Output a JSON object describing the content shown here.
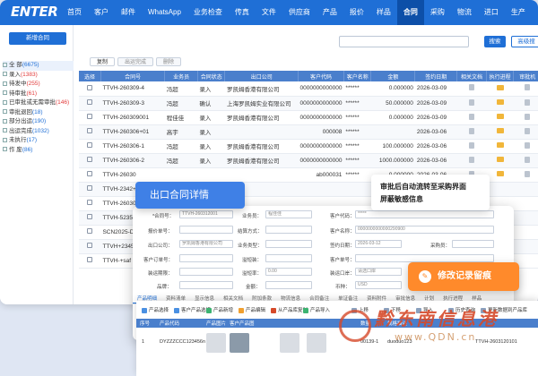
{
  "app": {
    "logo": "ENTER",
    "nav": [
      "首页",
      "客户",
      "邮件",
      "WhatsApp",
      "业务检查",
      "传真",
      "文件",
      "供应商",
      "产品",
      "报价",
      "样品",
      "合同",
      "采购",
      "物流",
      "进口",
      "生产"
    ],
    "active_nav": "合同"
  },
  "sidebar": {
    "new_button": "新增合同",
    "items": [
      {
        "label": "全 部",
        "count": "(6675)"
      },
      {
        "label": "录入",
        "count": "(1383)"
      },
      {
        "label": "待发中",
        "count": "(255)"
      },
      {
        "label": "待审批",
        "count": "(61)"
      },
      {
        "label": "已审批或无需审批",
        "count": "(146)"
      },
      {
        "label": "审批退回",
        "count": "(18)"
      },
      {
        "label": "部分出运",
        "count": "(190)"
      },
      {
        "label": "出运完成",
        "count": "(1032)"
      },
      {
        "label": "未执行",
        "count": "(17)"
      },
      {
        "label": "作 废",
        "count": "(86)"
      }
    ]
  },
  "toolbar": {
    "search_button": "搜索",
    "advanced_button": "高级搜",
    "buttons": [
      "复制",
      "出运完成",
      "删除"
    ]
  },
  "table": {
    "headers": [
      "选择",
      "合同号",
      "业务员",
      "合同状态",
      "出口公司",
      "客户代码",
      "客户名称",
      "金额",
      "签约日期",
      "相关文档",
      "执行进程",
      "审批机"
    ],
    "rows": [
      [
        "TTVH-260309-4",
        "冯超",
        "录入",
        "罗凯姆香港有限公司",
        "0000000000000",
        "******",
        "0.000000",
        "2026-03-09"
      ],
      [
        "TTVH-260309-3",
        "冯超",
        "确认",
        "上海罗凯姆实业有限公司",
        "0000000000000",
        "******",
        "50.000000",
        "2026-03-09"
      ],
      [
        "TTVH-260309001",
        "程佳佳",
        "录入",
        "罗凯姆香港有限公司",
        "0000000000000",
        "******",
        "0.000000",
        "2026-03-09"
      ],
      [
        "TTVH-260306+01",
        "高宇",
        "录入",
        "",
        "000008",
        "******",
        "",
        "2026-03-06"
      ],
      [
        "TTVH-260306-1",
        "冯超",
        "录入",
        "罗凯姆香港有限公司",
        "0000000000000",
        "******",
        "100.000000",
        "2026-03-06"
      ],
      [
        "TTVH-260306-2",
        "冯超",
        "录入",
        "罗凯姆香港有限公司",
        "0000000000000",
        "******",
        "1000.000000",
        "2026-03-06"
      ],
      [
        "TTVH-26030",
        "",
        "",
        "",
        "ab000031",
        "******",
        "0.000000",
        "2026-03-06"
      ],
      [
        "TTVH-2342+",
        "",
        "",
        "",
        "",
        "",
        "",
        ""
      ],
      [
        "TTVH-26030",
        "",
        "",
        "",
        "",
        "",
        "",
        ""
      ],
      [
        "TTVH-52352",
        "",
        "",
        "",
        "",
        "",
        "",
        ""
      ],
      [
        "SCN2025-D8",
        "",
        "",
        "",
        "",
        "",
        "",
        ""
      ],
      [
        "TTVH+23453",
        "",
        "",
        "",
        "",
        "",
        "",
        ""
      ],
      [
        "TTVH-+saf",
        "",
        "",
        "",
        "",
        "",
        "",
        ""
      ]
    ]
  },
  "detail": {
    "callout": "出口合同详情",
    "fields": {
      "contract_no_label": "*合同号：",
      "contract_no_value": "TTVH-260312001",
      "salesperson_label": "业务员：",
      "salesperson_value": "程佳佳",
      "customer_code_label": "客户代码：",
      "customer_code_value": "*****",
      "quote_no_label": "报价单号：",
      "settlement_label": "结算方式：",
      "customer_name_label": "客户名称：",
      "customer_name_value": "0000000000000290900",
      "export_company_label": "出口公司：",
      "export_company_value": "罗凯姆香港有限公司",
      "business_type_label": "业务类型：",
      "sign_date_label": "签约日期：",
      "sign_date_value": "2026-03-12",
      "purchaser_label": "采购员：",
      "customer_order_label": "客户订单号：",
      "delivery_label": "溢短装：",
      "customer_po_label": "客户单号：",
      "ship_date_label": "装运期限：",
      "deposit_label": "溢短率：",
      "deposit_value": "0.00",
      "port_label": "装运口岸：",
      "port_value": "请选口岸",
      "brand_label": "品牌：",
      "coinage_label": "金额：",
      "currency_label": "币种：",
      "currency_value": "USD"
    },
    "tabs": [
      "产品明细",
      "资料清单",
      "显示信息",
      "相关文档",
      "附加条款",
      "物流信息",
      "合同备注",
      "单证备注",
      "资料附件",
      "审批信息",
      "计划",
      "执行进程",
      "样品"
    ]
  },
  "callout_top_right": {
    "line1": "审批后自动流转至采购界面",
    "line2": "屏蔽敏感信息"
  },
  "callout_orange": "修改记录留痕",
  "product": {
    "tools": [
      "产品选择",
      "客户产品选择",
      "产品新增",
      "产品编辑",
      "从产品库复制",
      "产品导入"
    ],
    "tools_right": [
      "上移",
      "下移",
      "导入",
      "历史查询",
      "更新数据到产品库"
    ],
    "headers": [
      "序号",
      "产品代码",
      "产品图片",
      "客户产品图",
      "",
      "",
      "",
      "",
      "数量",
      "",
      "",
      "规格描述"
    ],
    "row": {
      "index": "1",
      "code": "DYZZZCCC123456n",
      "customer_code": "00139-1",
      "spec_code": "duoduo123",
      "tail_code": "TTVH-2603120101"
    }
  },
  "watermark": {
    "text": "黔东南信息港",
    "url": "www.QDN.cn"
  }
}
